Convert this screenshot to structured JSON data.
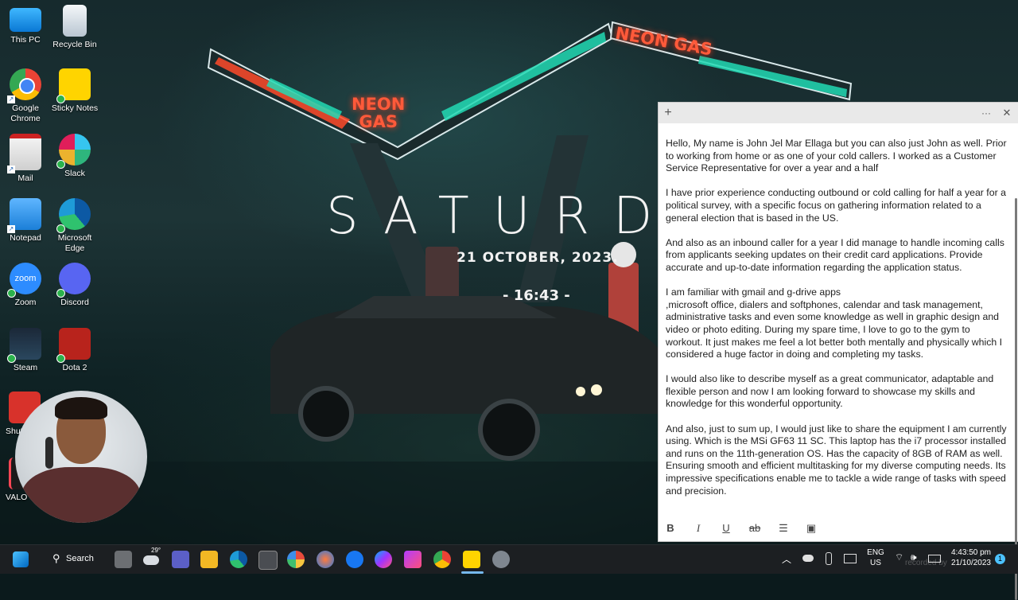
{
  "wallpaper": {
    "sign_left_line1": "NEON",
    "sign_left_line2": "GAS",
    "sign_right": "NEON GAS",
    "day": "SATURDA",
    "date": "21 OCTOBER, 2023.",
    "time": "- 16:43 -"
  },
  "desktop_icons": [
    {
      "label": "This PC",
      "icon": "this-pc-icon"
    },
    {
      "label": "Recycle Bin",
      "icon": "recycle-bin-icon"
    },
    {
      "label": "Google Chrome",
      "icon": "chrome-icon"
    },
    {
      "label": "Sticky Notes",
      "icon": "sticky-notes-icon"
    },
    {
      "label": "Mail",
      "icon": "mail-icon"
    },
    {
      "label": "Slack",
      "icon": "slack-icon"
    },
    {
      "label": "Notepad",
      "icon": "notepad-icon"
    },
    {
      "label": "Microsoft Edge",
      "icon": "edge-icon"
    },
    {
      "label": "Zoom",
      "icon": "zoom-icon"
    },
    {
      "label": "Discord",
      "icon": "discord-icon"
    },
    {
      "label": "Steam",
      "icon": "steam-icon"
    },
    {
      "label": "Dota 2",
      "icon": "dota2-icon"
    },
    {
      "label": "Shut",
      "icon": "shutdown-icon"
    },
    {
      "label": "VALO",
      "icon": "valorant-icon"
    }
  ],
  "sticky_note": {
    "add_glyph": "+",
    "menu_glyph": "···",
    "close_glyph": "✕",
    "paragraphs": [
      "Hello, My name is John Jel Mar Ellaga but you can also  just John as well. Prior to working from home or as one of your cold callers. I worked as a Customer Service Representative for over a year and a half",
      "I have prior experience conducting outbound or cold calling for half a year for a political survey, with a specific focus on gathering information related to a general election that is based in the US.",
      "And also as an inbound caller for a year I did manage to handle incoming calls from applicants seeking updates on their credit card applications. Provide accurate and up-to-date information regarding the application status.",
      "I am familiar with gmail and g-drive apps\n,microsoft office, dialers and softphones, calendar and task management, administrative tasks and even some knowledge as well in graphic design and video or photo editing. During my spare time, I love to go to the gym to workout. It just makes me feel a lot better both mentally and physically which I considered a huge factor in doing and completing my tasks.",
      "I would also like to describe myself as a great communicator, adaptable and flexible person and now I am looking forward to showcase my skills and knowledge for this wonderful opportunity.",
      "And also, just to sum up, I would just like to share the equipment I am currently using. Which is the MSi GF63 11 SC. This laptop has the i7 processor installed and runs on the 11th-generation OS. Has the capacity of 8GB of RAM as well. Ensuring smooth and efficient multitasking for my diverse computing needs. Its impressive specifications enable me to tackle a wide range of tasks with speed and precision."
    ],
    "toolbar": {
      "bold": "B",
      "italic": "I",
      "underline": "U",
      "strikethrough": "ab",
      "bullets": "☰",
      "image": "▣"
    }
  },
  "taskbar": {
    "search_label": "Search",
    "weather_temp": "29°",
    "language_line1": "ENG",
    "language_line2": "US",
    "clock_time": "4:43:50 pm",
    "clock_date": "21/10/2023",
    "notification_count": "1",
    "watermark": "recorded by"
  }
}
